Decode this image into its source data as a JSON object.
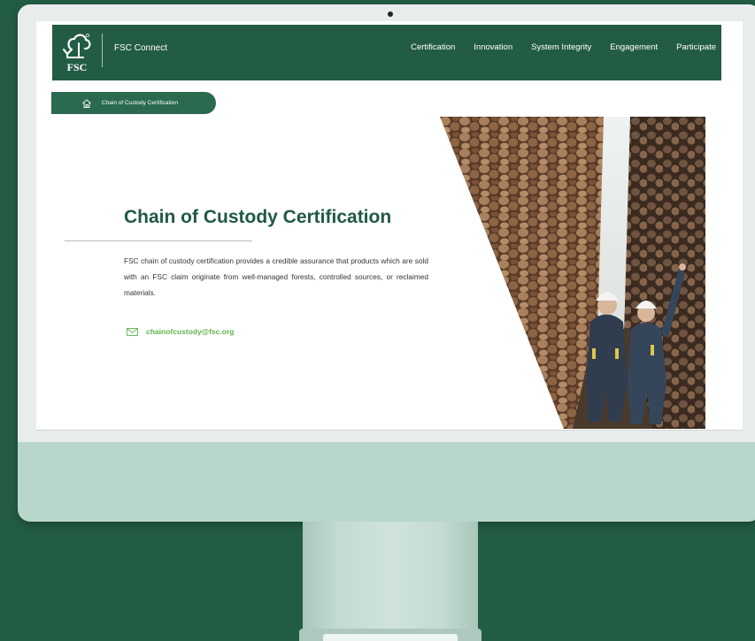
{
  "header": {
    "logo_text": "FSC",
    "brand_name": "FSC Connect",
    "nav_items": [
      "Certification",
      "Innovation",
      "System Integrity",
      "Engagement",
      "Participate"
    ]
  },
  "breadcrumb": {
    "home_icon": "home-icon",
    "current": "Chain of Custody Certification"
  },
  "hero": {
    "title": "Chain of Custody Certification",
    "description": "FSC chain of custody certification provides a credible assurance that products which are sold with an FSC claim originate from well-managed forests, controlled sources, or reclaimed materials.",
    "contact_icon": "mail-icon",
    "contact_email": "chainofcustody@fsc.org",
    "image": "timber-stacks-with-workers-photo"
  },
  "colors": {
    "brand_green": "#235c45",
    "title_green": "#1f5a42",
    "email_green": "#5fb34a",
    "device_mint": "#b9d6cb"
  }
}
